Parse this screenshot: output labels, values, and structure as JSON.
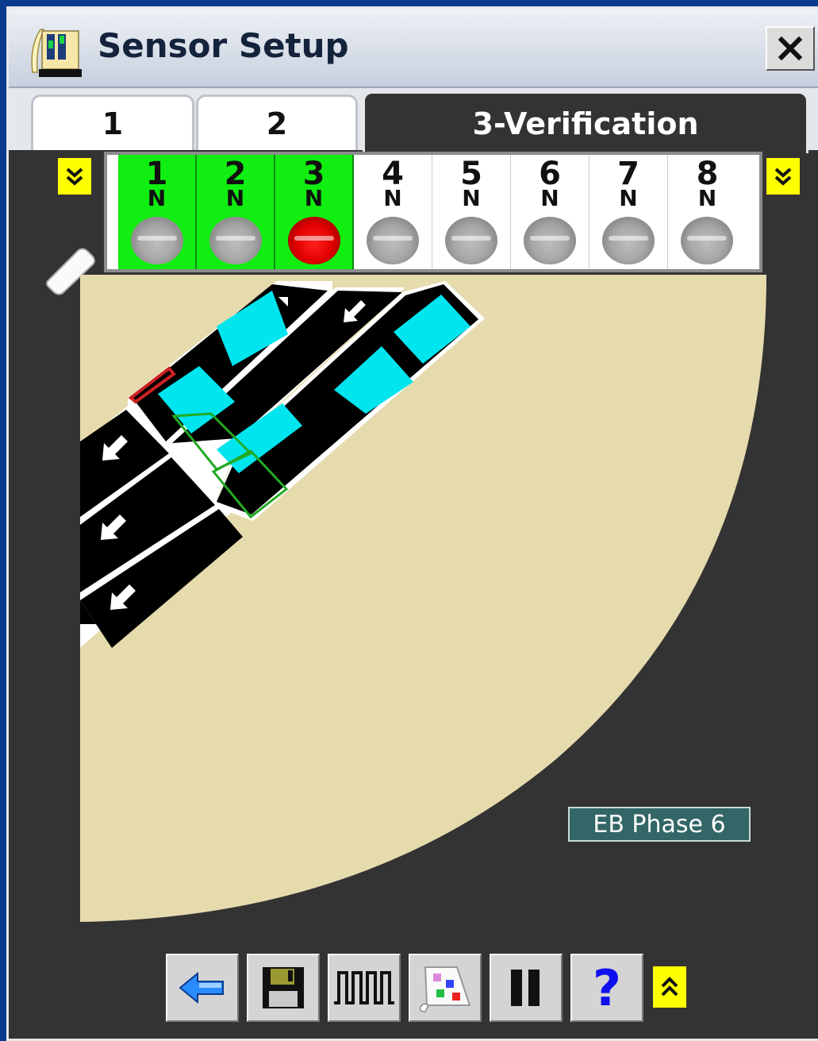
{
  "window": {
    "title": "Sensor Setup",
    "app_icon": "sensor-setup-app-icon",
    "close_icon": "close-icon"
  },
  "tabs": [
    {
      "label": "1",
      "active": false
    },
    {
      "label": "2",
      "active": false
    },
    {
      "label": "3-Verification",
      "active": true
    }
  ],
  "sensors": [
    {
      "number": "1",
      "mode": "N",
      "active": true,
      "state": "off"
    },
    {
      "number": "2",
      "mode": "N",
      "active": true,
      "state": "off"
    },
    {
      "number": "3",
      "mode": "N",
      "active": true,
      "state": "detect"
    },
    {
      "number": "4",
      "mode": "N",
      "active": false,
      "state": "off"
    },
    {
      "number": "5",
      "mode": "N",
      "active": false,
      "state": "off"
    },
    {
      "number": "6",
      "mode": "N",
      "active": false,
      "state": "off"
    },
    {
      "number": "7",
      "mode": "N",
      "active": false,
      "state": "off"
    },
    {
      "number": "8",
      "mode": "N",
      "active": false,
      "state": "off"
    }
  ],
  "colors": {
    "background": "#333333",
    "detection_area": "#e6dbad",
    "sensor_active": "#11ee11",
    "detect_led": "#e00000",
    "zone": "#00e5ee",
    "expand_button": "#ffff00",
    "phase_label": "#336666"
  },
  "map": {
    "phase_label": "EB Phase 6"
  },
  "toolbar": {
    "buttons": [
      "back-arrow-icon",
      "save-icon",
      "pulse-waveform-icon",
      "color-palette-icon",
      "pause-icon",
      "help-icon"
    ],
    "help_label": "?",
    "collapse_icon": "chevron-up-double-icon"
  },
  "side_buttons": [
    "chevron-down-double-icon",
    "chevron-down-double-icon"
  ]
}
